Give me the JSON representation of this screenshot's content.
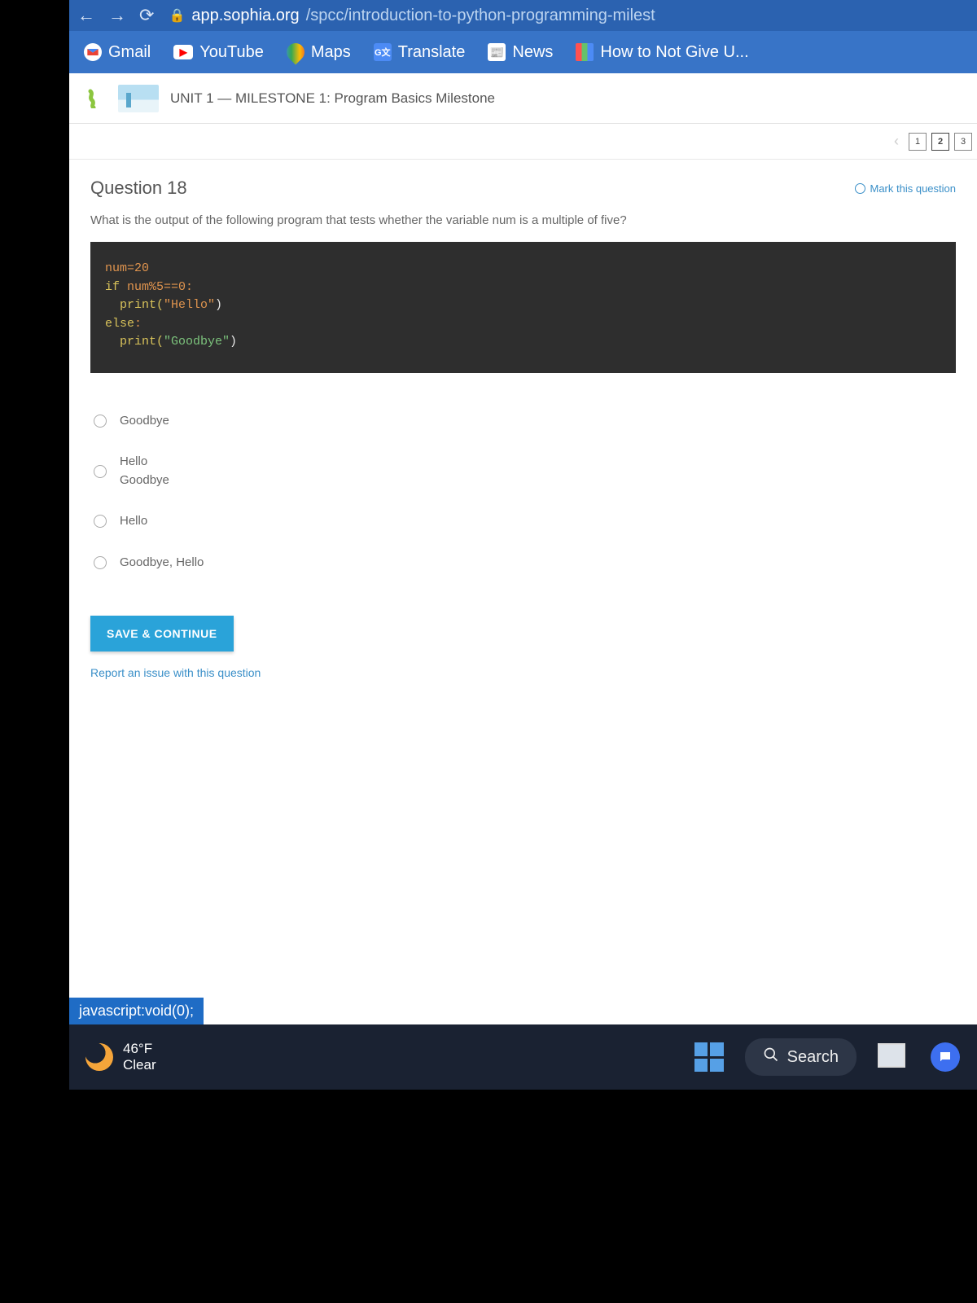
{
  "browser": {
    "url_host": "app.sophia.org",
    "url_path": "/spcc/introduction-to-python-programming-milest"
  },
  "bookmarks": {
    "gmail": "Gmail",
    "youtube": "YouTube",
    "maps": "Maps",
    "translate": "Translate",
    "news": "News",
    "how": "How to Not Give U..."
  },
  "app": {
    "unit_title": "UNIT 1 — MILESTONE 1: Program Basics Milestone"
  },
  "pagination": {
    "p1": "1",
    "p2": "2",
    "p3": "3"
  },
  "question": {
    "title": "Question 18",
    "mark_label": "Mark this question",
    "prompt": "What is the output of the following program that tests whether the variable num is a multiple of five?",
    "code": {
      "l1a": "num",
      "l1b": "=20",
      "l2a": "if",
      "l2b": " num%5==0:",
      "l3a": "  print(",
      "l3b": "\"Hello\"",
      "l3c": ")",
      "l4a": "else",
      "l4b": ":",
      "l5a": "  print(",
      "l5b": "\"Goodbye\"",
      "l5c": ")"
    },
    "answers": {
      "a": "Goodbye",
      "b": "Hello\nGoodbye",
      "c": "Hello",
      "d": "Goodbye, Hello"
    },
    "save_btn": "SAVE & CONTINUE",
    "report": "Report an issue with this question"
  },
  "status_link": "javascript:void(0);",
  "taskbar": {
    "temp": "46°F",
    "cond": "Clear",
    "search": "Search"
  }
}
